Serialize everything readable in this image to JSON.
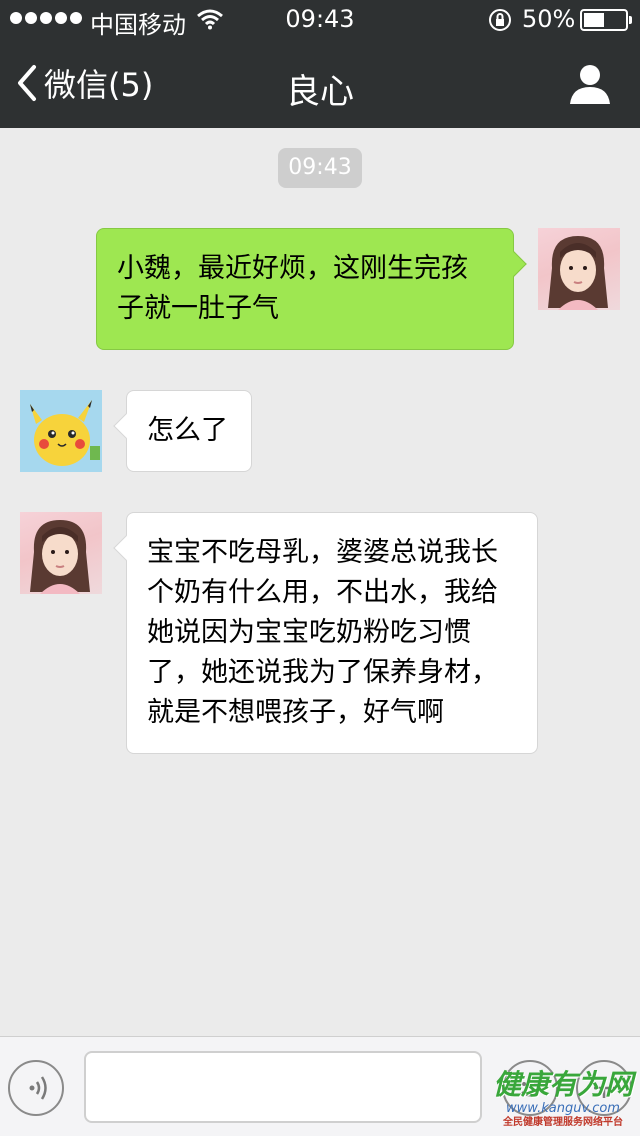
{
  "status_bar": {
    "carrier": "中国移动",
    "time": "09:43",
    "battery_percent_text": "50%",
    "battery_level": 0.5,
    "signal_icon": "signal-dots-icon",
    "wifi_icon": "wifi-icon",
    "rotation_lock_icon": "rotation-lock-icon"
  },
  "nav": {
    "back_label": "微信(5)",
    "title": "良心",
    "back_icon": "chevron-left-icon",
    "profile_icon": "person-icon"
  },
  "chat": {
    "timestamp": "09:43",
    "messages": [
      {
        "side": "right",
        "lines": [
          "小魏，最近好烦，这刚生完孩",
          "子就一肚子气"
        ],
        "avatar": "girl-avatar"
      },
      {
        "side": "left",
        "lines": [
          "怎么了"
        ],
        "avatar": "pikachu-avatar"
      },
      {
        "side": "left",
        "lines": [
          "宝宝不吃母乳，婆婆总说我长",
          "个奶有什么用，不出水，我给",
          "她说因为宝宝吃奶粉吃习惯",
          "了，她还说我为了保养身材，",
          "就是不想喂孩子，好气啊"
        ],
        "avatar": "girl-avatar"
      }
    ]
  },
  "input_bar": {
    "value": "",
    "voice_icon": "voice-icon",
    "emoji_icon": "emoji-icon",
    "plus_icon": "plus-icon"
  },
  "watermark": {
    "main": "健康有为网",
    "url": "www.kanguv.com",
    "sub": "全民健康管理服务网络平台"
  },
  "colors": {
    "bar_bg": "#2e3132",
    "chat_bg": "#ebebeb",
    "sent_bubble": "#9ee751",
    "received_bubble": "#ffffff"
  }
}
